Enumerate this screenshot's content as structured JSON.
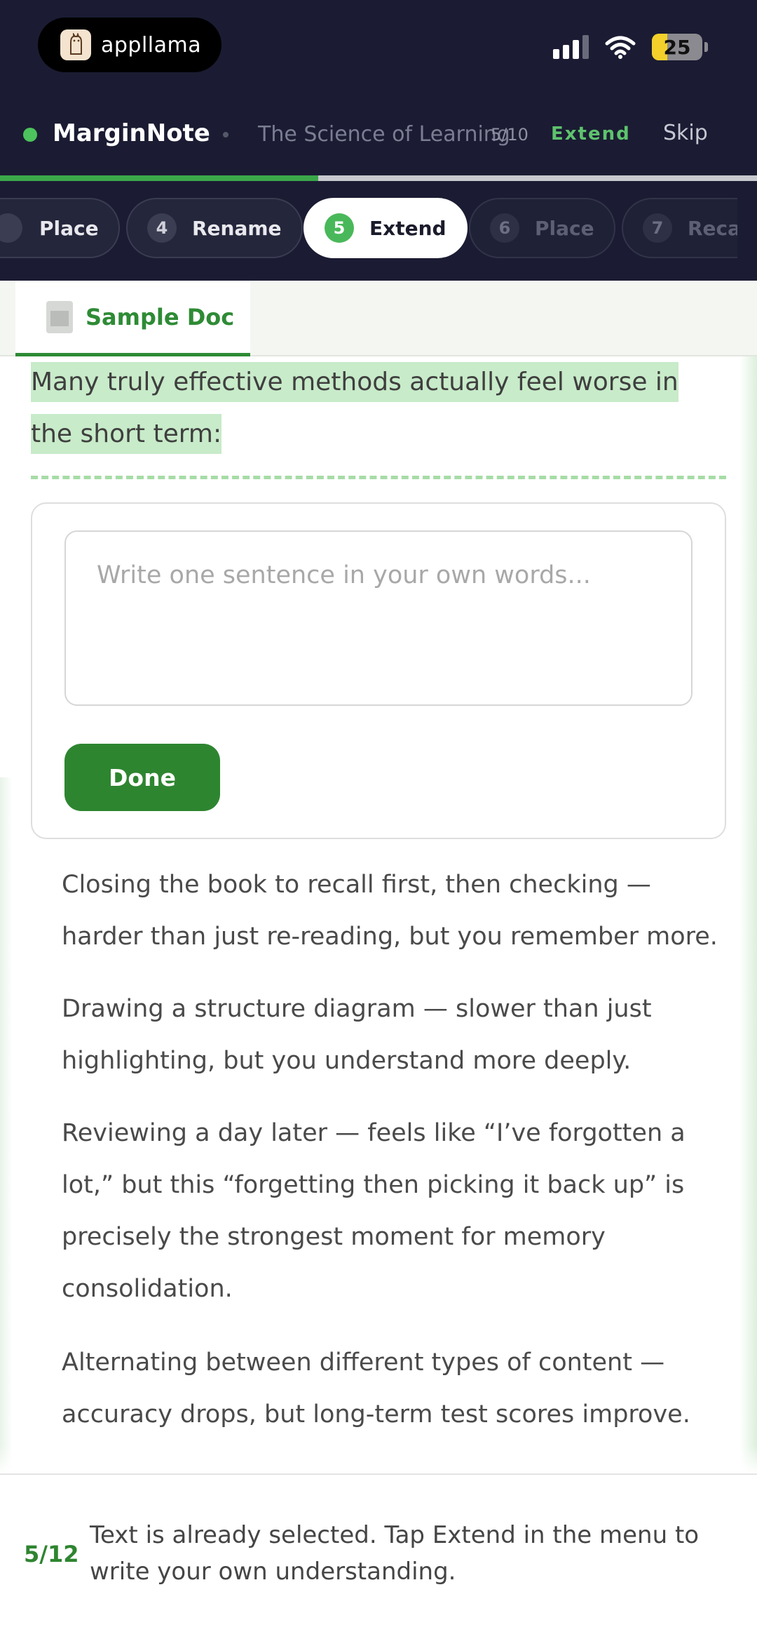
{
  "status_bar": {
    "app_pill_label": "appllama",
    "app_icon": "llama-icon",
    "battery_level": "25",
    "icons": [
      "signal-icon",
      "wifi-icon",
      "battery-icon"
    ],
    "colors": {
      "battery_fill": "#f3d12a"
    }
  },
  "nav": {
    "brand": "MarginNote",
    "course_title": "The Science of Learning",
    "progress": "5/10",
    "extend_label": "Extend",
    "skip_label": "Skip",
    "progress_fraction": 0.42,
    "colors": {
      "accent": "#3ba74a",
      "background": "#1b1c33"
    }
  },
  "steps": [
    {
      "number": "",
      "label": "Place",
      "state": "done"
    },
    {
      "number": "4",
      "label": "Rename",
      "state": "done"
    },
    {
      "number": "5",
      "label": "Extend",
      "state": "active"
    },
    {
      "number": "6",
      "label": "Place",
      "state": "upcoming"
    },
    {
      "number": "7",
      "label": "Recal",
      "state": "upcoming"
    }
  ],
  "doc_tab": {
    "title": "Sample Doc",
    "icon": "document-icon"
  },
  "content": {
    "highlighted_text": "Many truly effective methods actually feel worse in the short term:",
    "card": {
      "input_placeholder": "Write one sentence in your own words...",
      "input_value": "",
      "done_label": "Done"
    },
    "paragraphs": [
      "Closing the book to recall first, then checking — harder than just re-reading, but you remember more.",
      "Drawing a structure diagram — slower than just highlighting, but you understand more deeply.",
      "Reviewing a day later — feels like “I’ve forgotten a lot,” but this “forgetting then picking it back up” is precisely the strongest moment for memory consolidation.",
      "Alternating between different types of content — accuracy drops, but long-term test scores improve."
    ],
    "colors": {
      "highlight": "#c8ebc9",
      "primary_button": "#2e8530"
    }
  },
  "hint": {
    "count": "5/12",
    "text": "Text is already selected. Tap Extend in the menu to write your own understanding."
  }
}
